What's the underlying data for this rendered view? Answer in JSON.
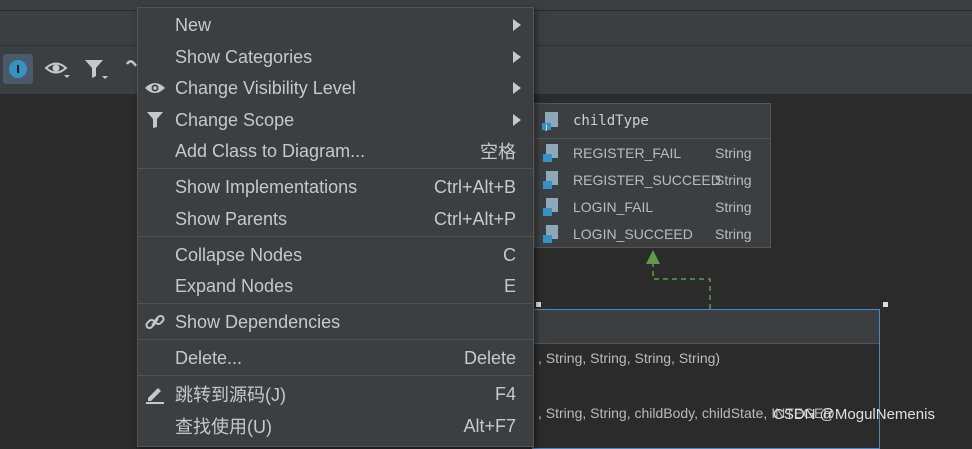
{
  "toolbar": {
    "icons": [
      "info-icon",
      "eye-icon",
      "filter-icon",
      "link-icon"
    ]
  },
  "context_menu": {
    "items": [
      {
        "label": "New",
        "submenu": true
      },
      {
        "label": "Show Categories",
        "submenu": true
      },
      {
        "label": "Change Visibility Level",
        "submenu": true,
        "icon": "eye-icon"
      },
      {
        "label": "Change Scope",
        "submenu": true,
        "icon": "filter-icon"
      },
      {
        "label": "Add Class to Diagram...",
        "shortcut": "空格"
      },
      {
        "label": "Show Implementations",
        "shortcut": "Ctrl+Alt+B"
      },
      {
        "label": "Show Parents",
        "shortcut": "Ctrl+Alt+P"
      },
      {
        "label": "Collapse Nodes",
        "shortcut": "C"
      },
      {
        "label": "Expand Nodes",
        "shortcut": "E"
      },
      {
        "label": "Show Dependencies",
        "icon": "link-icon"
      },
      {
        "label": "Delete...",
        "shortcut": "Delete"
      },
      {
        "label": "跳转到源码(J)",
        "shortcut": "F4",
        "icon": "edit-icon"
      },
      {
        "label": "查找使用(U)",
        "shortcut": "Alt+F7"
      }
    ]
  },
  "diagram": {
    "enum_node": {
      "title": "childType",
      "fields": [
        {
          "name": "REGISTER_FAIL",
          "type": "String"
        },
        {
          "name": "REGISTER_SUCCEED",
          "type": "String"
        },
        {
          "name": "LOGIN_FAIL",
          "type": "String"
        },
        {
          "name": "LOGIN_SUCCEED",
          "type": "String"
        }
      ]
    },
    "class_node": {
      "constructors": [
        ", String, String, String, String)",
        ", String, String, childBody, childState, INTEGER"
      ]
    },
    "colors": {
      "selection_border": "#4a88c7",
      "arrow": "#5f9a4e"
    }
  },
  "watermark": "CSDN @MogulNemenis"
}
